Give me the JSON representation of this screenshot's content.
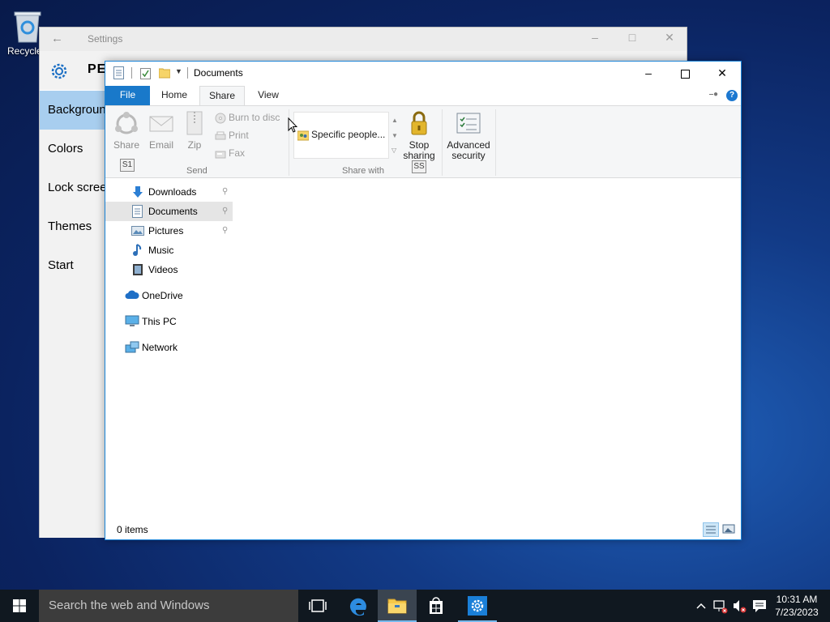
{
  "desktop": {
    "recycle_label": "Recycle"
  },
  "settings": {
    "title": "Settings",
    "heading": "PER",
    "nav": [
      "Backgroun",
      "Colors",
      "Lock screen",
      "Themes",
      "Start"
    ]
  },
  "explorer": {
    "title": "Documents",
    "tabs": {
      "file": "File",
      "home": "Home",
      "share": "Share",
      "view": "View"
    },
    "ribbon": {
      "share": "Share",
      "email": "Email",
      "zip": "Zip",
      "burn": "Burn to disc",
      "print": "Print",
      "fax": "Fax",
      "send_group": "Send",
      "share_with_item": "Specific people...",
      "share_with_group": "Share with",
      "stop_sharing_1": "Stop",
      "stop_sharing_2": "sharing",
      "advanced_1": "Advanced",
      "advanced_2": "security",
      "keytip_s1": "S1",
      "keytip_ss": "SS"
    },
    "nav": {
      "downloads": "Downloads",
      "documents": "Documents",
      "pictures": "Pictures",
      "music": "Music",
      "videos": "Videos",
      "onedrive": "OneDrive",
      "thispc": "This PC",
      "network": "Network"
    },
    "status": "0 items"
  },
  "taskbar": {
    "search_placeholder": "Search the web and Windows",
    "time": "10:31 AM",
    "date": "7/23/2023"
  },
  "colors": {
    "accent": "#1979ca",
    "selection": "#a8ceef",
    "taskbar": "#101820"
  }
}
